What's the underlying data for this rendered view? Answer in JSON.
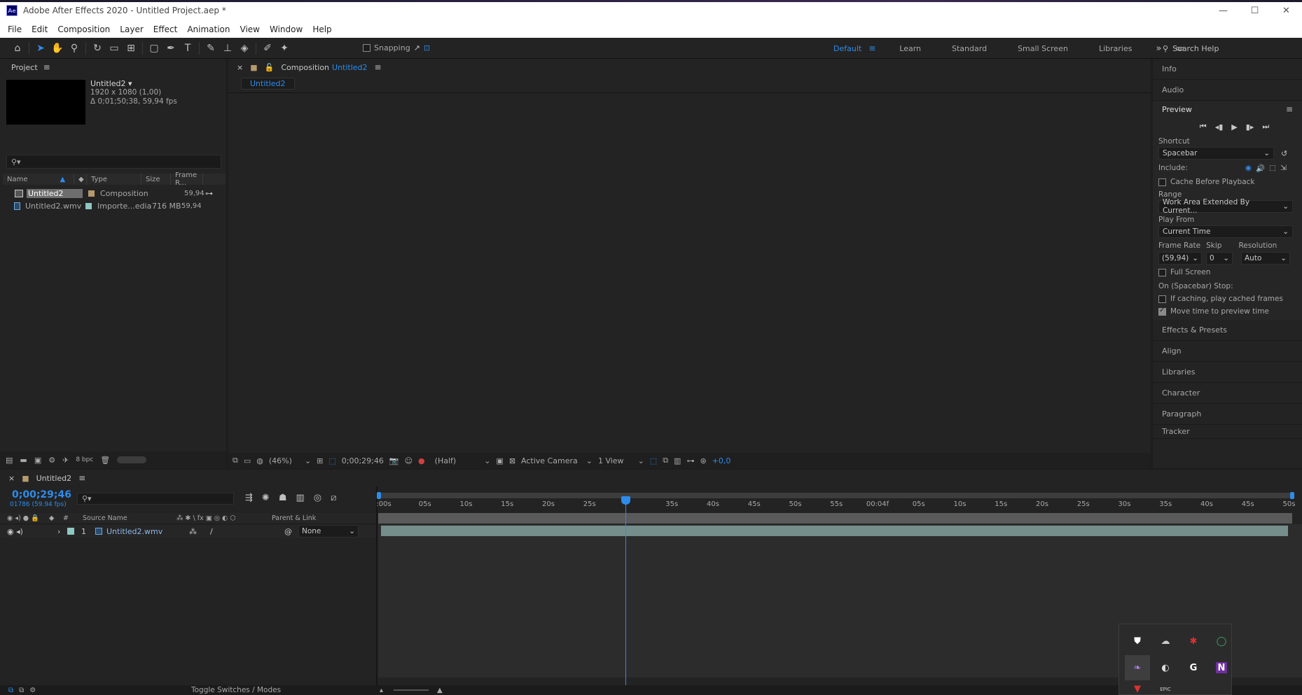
{
  "window": {
    "title": "Adobe After Effects 2020 - Untitled Project.aep *",
    "app_icon": "Ae",
    "minimize": "—",
    "maximize": "☐",
    "close": "✕"
  },
  "menu": [
    "File",
    "Edit",
    "Composition",
    "Layer",
    "Effect",
    "Animation",
    "View",
    "Window",
    "Help"
  ],
  "toolbar": {
    "snapping_label": "Snapping",
    "workspaces": [
      "Default",
      "Learn",
      "Standard",
      "Small Screen",
      "Libraries"
    ],
    "active_workspace": "Default",
    "more": "»",
    "search_help": "Search Help"
  },
  "project": {
    "title": "Project",
    "selected_item": {
      "name": "Untitled2 ▾",
      "dimensions": "1920 x 1080 (1,00)",
      "duration": "Δ 0;01;50;38, 59,94 fps"
    },
    "search_placeholder": "",
    "columns": [
      "Name",
      "Type",
      "Size",
      "Frame R..."
    ],
    "items": [
      {
        "name": "Untitled2",
        "type": "Composition",
        "size": "",
        "fps": "59,94",
        "label_color": "#b59a6e"
      },
      {
        "name": "Untitled2.wmv",
        "type": "Importe...edia",
        "size": "716 MB",
        "fps": "59,94",
        "label_color": "#8fc7c2"
      }
    ],
    "bpc": "8 bpc"
  },
  "composition": {
    "tab_prefix": "Composition",
    "tab_name": "Untitled2",
    "view_tab": "Untitled2",
    "footer": {
      "zoom": "(46%)",
      "timecode": "0;00;29;46",
      "resolution": "(Half)",
      "camera": "Active Camera",
      "views": "1 View",
      "exposure": "+0,0"
    }
  },
  "right_panels": {
    "info": "Info",
    "audio": "Audio",
    "preview": {
      "title": "Preview",
      "shortcut_label": "Shortcut",
      "shortcut_value": "Spacebar",
      "include_label": "Include:",
      "cache_before_playback": "Cache Before Playback",
      "range_label": "Range",
      "range_value": "Work Area Extended By Current...",
      "play_from_label": "Play From",
      "play_from_value": "Current Time",
      "frame_rate_label": "Frame Rate",
      "skip_label": "Skip",
      "resolution_label": "Resolution",
      "frame_rate_value": "(59,94)",
      "skip_value": "0",
      "resolution_value": "Auto",
      "full_screen": "Full Screen",
      "stop_label": "On (Spacebar) Stop:",
      "if_caching": "If caching, play cached frames",
      "move_time": "Move time to preview time"
    },
    "effects_presets": "Effects & Presets",
    "align": "Align",
    "libraries": "Libraries",
    "character": "Character",
    "paragraph": "Paragraph",
    "tracker": "Tracker"
  },
  "timeline": {
    "comp_name": "Untitled2",
    "current_time": "0;00;29;46",
    "frame_info": "01786 (59.94 fps)",
    "columns": {
      "num": "#",
      "source_name": "Source Name",
      "parent_link": "Parent & Link"
    },
    "layer": {
      "num": "1",
      "name": "Untitled2.wmv",
      "parent": "None"
    },
    "ruler_ticks": [
      ":00s",
      "05s",
      "10s",
      "15s",
      "20s",
      "25s",
      "",
      "35s",
      "40s",
      "45s",
      "50s",
      "55s",
      "00:04f",
      "05s",
      "10s",
      "15s",
      "20s",
      "25s",
      "30s",
      "35s",
      "40s",
      "45s",
      "50s"
    ],
    "toggle_label": "Toggle Switches / Modes"
  },
  "tray_icons": [
    "shield-warning-icon",
    "cloud-off-icon",
    "red-bug-icon",
    "green-circle-icon",
    "feather-icon",
    "dark-arc-icon",
    "g-letter-icon",
    "n-purple-icon",
    "red-arrow-icon",
    "epic-icon"
  ]
}
